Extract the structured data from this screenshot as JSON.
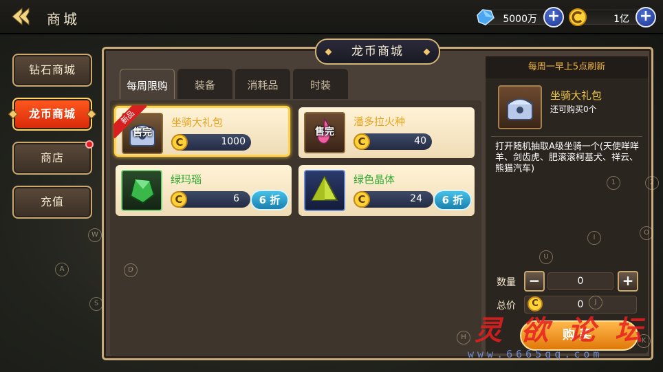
{
  "header": {
    "title": "商城"
  },
  "currency": [
    {
      "name": "diamond",
      "value": "5000万",
      "icon": "diamond-icon",
      "add_label": "+"
    },
    {
      "name": "dragon-coin",
      "value": "1亿",
      "icon": "coin-icon",
      "add_label": "+"
    }
  ],
  "left_tabs": [
    {
      "label": "钻石商城",
      "active": false
    },
    {
      "label": "龙币商城",
      "active": true
    },
    {
      "label": "商店",
      "active": false,
      "badge": true
    },
    {
      "label": "充值",
      "active": false
    }
  ],
  "panel": {
    "title": "龙币商城"
  },
  "sub_tabs": [
    {
      "label": "每周限购",
      "active": true
    },
    {
      "label": "装备",
      "active": false
    },
    {
      "label": "消耗品",
      "active": false
    },
    {
      "label": "时装",
      "active": false
    }
  ],
  "items": [
    {
      "name": "坐骑大礼包",
      "price": "1000",
      "badge": "新品",
      "status": "售完",
      "discount": "",
      "name_color": "#e8a31e",
      "icon": "chest-icon",
      "selected": true
    },
    {
      "name": "潘多拉火种",
      "price": "40",
      "badge": "",
      "status": "售完",
      "discount": "",
      "name_color": "#e8a31e",
      "icon": "flame-icon",
      "selected": false
    },
    {
      "name": "绿玛瑙",
      "price": "6",
      "badge": "",
      "status": "",
      "discount": "6 折",
      "name_color": "#2ea82e",
      "icon": "green-gem-icon",
      "selected": false
    },
    {
      "name": "绿色晶体",
      "price": "24",
      "badge": "",
      "status": "",
      "discount": "6 折",
      "name_color": "#2ea82e",
      "icon": "crystal-icon",
      "selected": false
    }
  ],
  "coin_glyph": "C",
  "detail": {
    "refresh": "每周一早上5点刷新",
    "name": "坐骑大礼包",
    "remaining": "还可购买0个",
    "description": "打开随机抽取A级坐骑一个(天使咩咩羊、剑齿虎、肥滚滚柯基犬、祥云、熊猫汽车)",
    "qty_label": "数量",
    "qty_value": "0",
    "minus": "−",
    "plus": "+",
    "total_label": "总价",
    "total_value": "0",
    "buy_label": "购买"
  },
  "key_hints": [
    "W",
    "A",
    "S",
    "D",
    "1",
    "2",
    "I",
    "O",
    "U",
    "J",
    "H",
    "K"
  ],
  "watermark": {
    "text": "灵欲论坛",
    "url": "www.6665gq.com"
  }
}
